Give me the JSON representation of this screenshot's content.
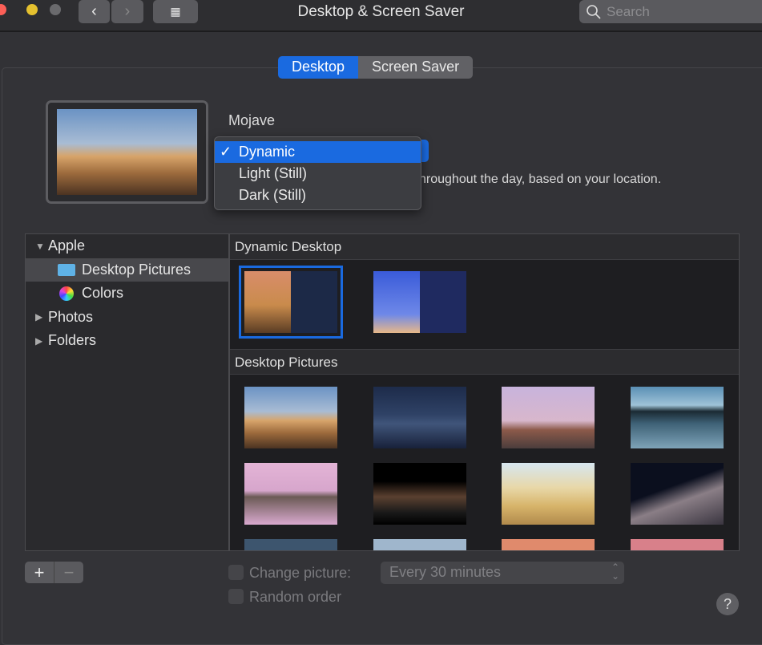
{
  "window": {
    "title": "Desktop & Screen Saver",
    "search_placeholder": "Search",
    "colors": {
      "close": "#fc5f57",
      "minimize": "#e5c12f",
      "zoom": "#6a6a6d",
      "accent": "#1a6ae0"
    }
  },
  "tabs": [
    {
      "label": "Desktop",
      "selected": true
    },
    {
      "label": "Screen Saver",
      "selected": false
    }
  ],
  "wallpaper": {
    "name": "Mojave",
    "description_visible": "hroughout the day, based on your location.",
    "menu": [
      {
        "label": "Dynamic",
        "checked": true
      },
      {
        "label": "Light (Still)"
      },
      {
        "label": "Dark (Still)"
      }
    ]
  },
  "sidebar": {
    "items": [
      {
        "label": "Apple",
        "expanded": true
      },
      {
        "label": "Desktop Pictures",
        "selected": true
      },
      {
        "label": "Colors"
      },
      {
        "label": "Photos"
      },
      {
        "label": "Folders"
      }
    ]
  },
  "sections": {
    "dynamic": "Dynamic Desktop",
    "pictures": "Desktop Pictures"
  },
  "bottom": {
    "add": "+",
    "remove": "−",
    "change_picture": "Change picture:",
    "interval": "Every 30 minutes",
    "random": "Random order",
    "help": "?"
  }
}
